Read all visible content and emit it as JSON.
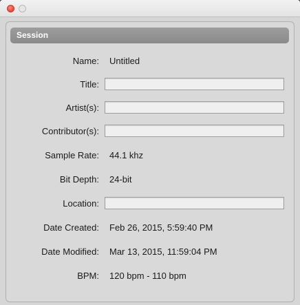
{
  "window": {
    "colors": {
      "close_button": "#e2463b",
      "section_header": "#959595",
      "panel_background": "#d9d9d9"
    }
  },
  "session": {
    "header": "Session",
    "fields": {
      "name": {
        "label": "Name:",
        "value": "Untitled"
      },
      "title": {
        "label": "Title:",
        "value": ""
      },
      "artists": {
        "label": "Artist(s):",
        "value": ""
      },
      "contributors": {
        "label": "Contributor(s):",
        "value": ""
      },
      "sample_rate": {
        "label": "Sample Rate:",
        "value": "44.1 khz"
      },
      "bit_depth": {
        "label": "Bit Depth:",
        "value": "24-bit"
      },
      "location": {
        "label": "Location:",
        "value": ""
      },
      "date_created": {
        "label": "Date Created:",
        "value": "Feb 26, 2015, 5:59:40 PM"
      },
      "date_modified": {
        "label": "Date Modified:",
        "value": "Mar 13, 2015, 11:59:04 PM"
      },
      "bpm": {
        "label": "BPM:",
        "value": "120 bpm - 110 bpm"
      }
    }
  }
}
